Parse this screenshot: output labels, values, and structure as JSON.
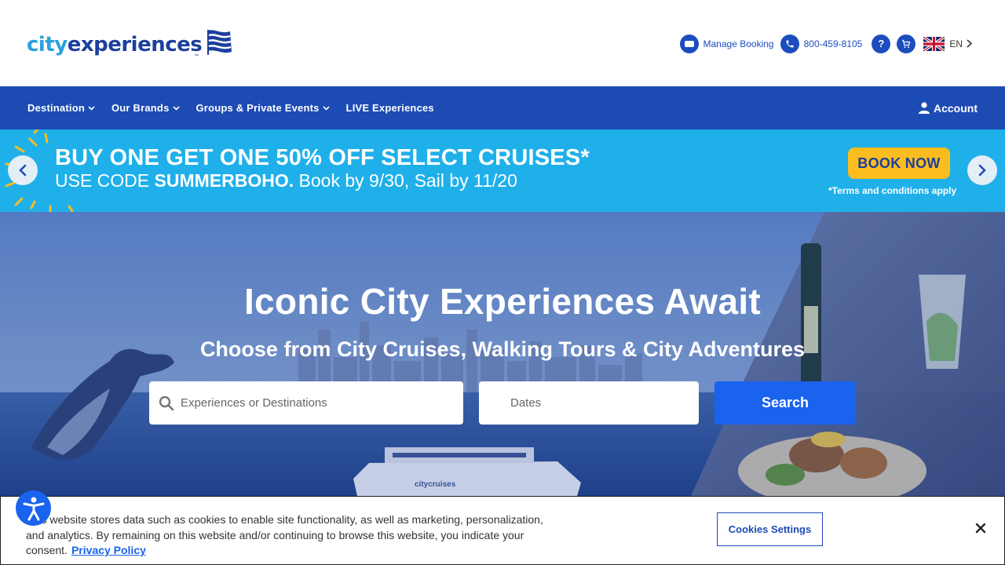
{
  "header": {
    "logo": {
      "part1": "city",
      "part2": "experiences",
      "tm": "™"
    },
    "utility": {
      "manage_booking": "Manage Booking",
      "phone": "800-459-8105",
      "help_label": "?",
      "language": "EN"
    }
  },
  "nav": {
    "items": [
      {
        "label": "Destination",
        "dropdown": true
      },
      {
        "label": "Our Brands",
        "dropdown": true
      },
      {
        "label": "Groups & Private Events",
        "dropdown": true
      },
      {
        "label": "LIVE Experiences",
        "dropdown": false
      }
    ],
    "account": "Account"
  },
  "promo": {
    "title": "BUY ONE GET ONE 50% OFF SELECT CRUISES*",
    "sub_prefix": "USE CODE ",
    "code": "SUMMERBOHO.",
    "sub_suffix": " Book by 9/30, Sail by 11/20",
    "cta": "BOOK NOW",
    "terms": "*Terms and conditions apply"
  },
  "hero": {
    "title": "Iconic City Experiences Await",
    "subtitle": "Choose from City Cruises, Walking Tours & City Adventures",
    "search": {
      "experience_placeholder": "Experiences or Destinations",
      "dates_placeholder": "Dates",
      "button": "Search"
    },
    "boat_label": "citycruises"
  },
  "cookie": {
    "text": "This website stores data such as cookies to enable site functionality, as well as marketing, personalization, and analytics. By remaining on this website and/or continuing to browse this website, you indicate your consent.",
    "privacy_link": "Privacy Policy",
    "settings_button": "Cookies Settings"
  },
  "colors": {
    "brand_blue": "#1c4bb4",
    "promo_cyan": "#1fb0ea",
    "cta_yellow": "#fbbc1e",
    "search_blue": "#1a63ee"
  }
}
